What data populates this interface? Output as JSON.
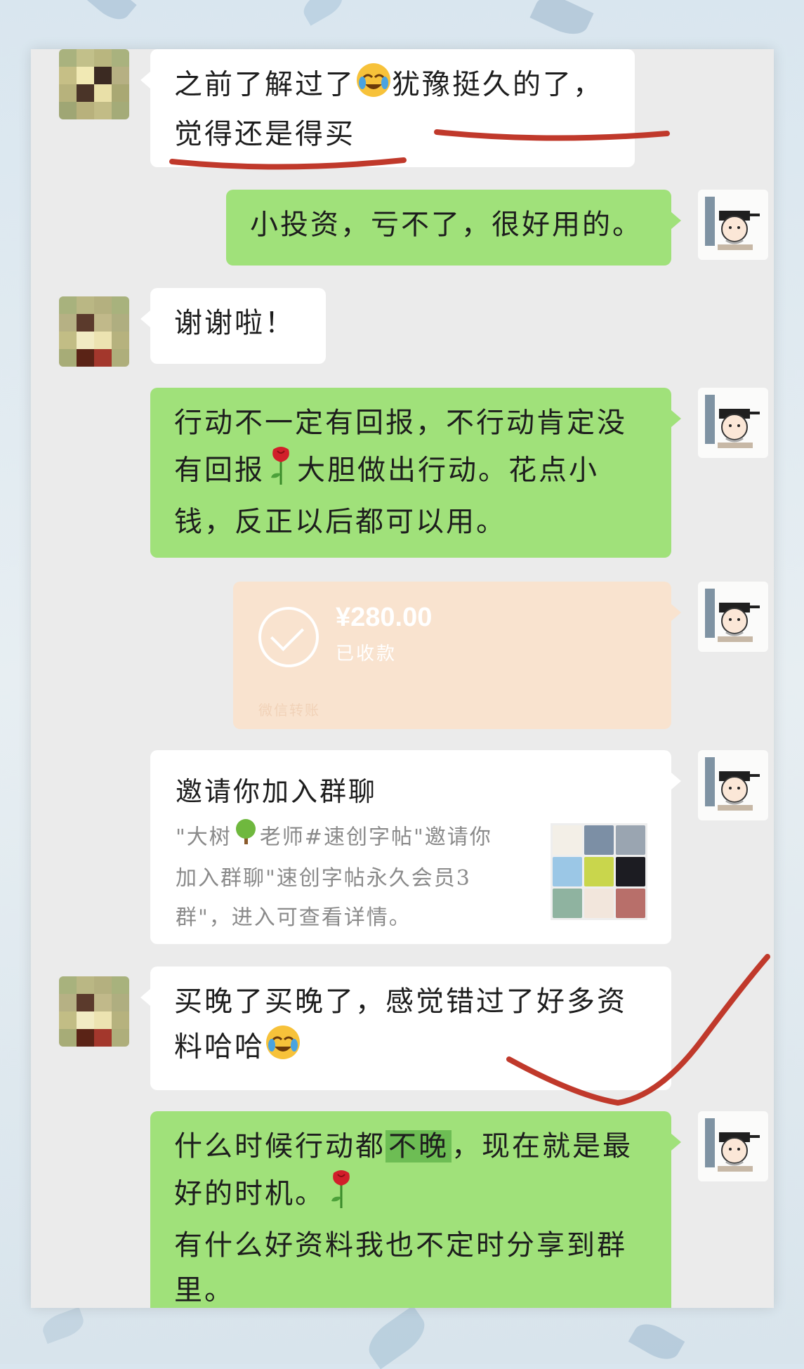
{
  "messages": [
    {
      "side": "left",
      "text_line1": "之前了解过了",
      "text_line1b": "犹豫挺久的了，",
      "text_line2": "觉得还是得买",
      "emoji": "crying-laughing-face"
    },
    {
      "side": "right",
      "text": "小投资，亏不了，很好用的。"
    },
    {
      "side": "left",
      "text": "谢谢啦！"
    },
    {
      "side": "right",
      "line1": "行动不一定有回报，不行动肯定没",
      "line2a": "有回报",
      "line2b": "大胆做出行动。花点小",
      "line3": "钱，反正以后都可以用。",
      "emoji": "rose"
    },
    {
      "side": "right",
      "type": "transfer",
      "amount": "¥280.00",
      "status": "已收款",
      "footer": "微信转账"
    },
    {
      "side": "right",
      "type": "invite",
      "title": "邀请你加入群聊",
      "desc_a": "\"大树",
      "desc_b": "老师#速创字帖\"邀请你",
      "desc_line2": "加入群聊\"速创字帖永久会员3",
      "desc_line3": "群\"，进入可查看详情。"
    },
    {
      "side": "left",
      "line1": "买晚了买晚了，感觉错过了好多资",
      "line2": "料哈哈",
      "emoji": "crying-laughing-face"
    },
    {
      "side": "right",
      "line1a": "什么时候行动都",
      "line1_highlight": "不晚",
      "line1b": "，现在就是最",
      "line2": "好的时机。",
      "line3": "有什么好资料我也不定时分享到群",
      "line4": "里。",
      "emoji": "rose"
    }
  ],
  "colors": {
    "chat_bg": "#ebebeb",
    "self_bubble": "#a0e17a",
    "other_bubble": "#ffffff",
    "transfer_bg": "#f9e3cf",
    "annotation_red": "#c0392b"
  }
}
